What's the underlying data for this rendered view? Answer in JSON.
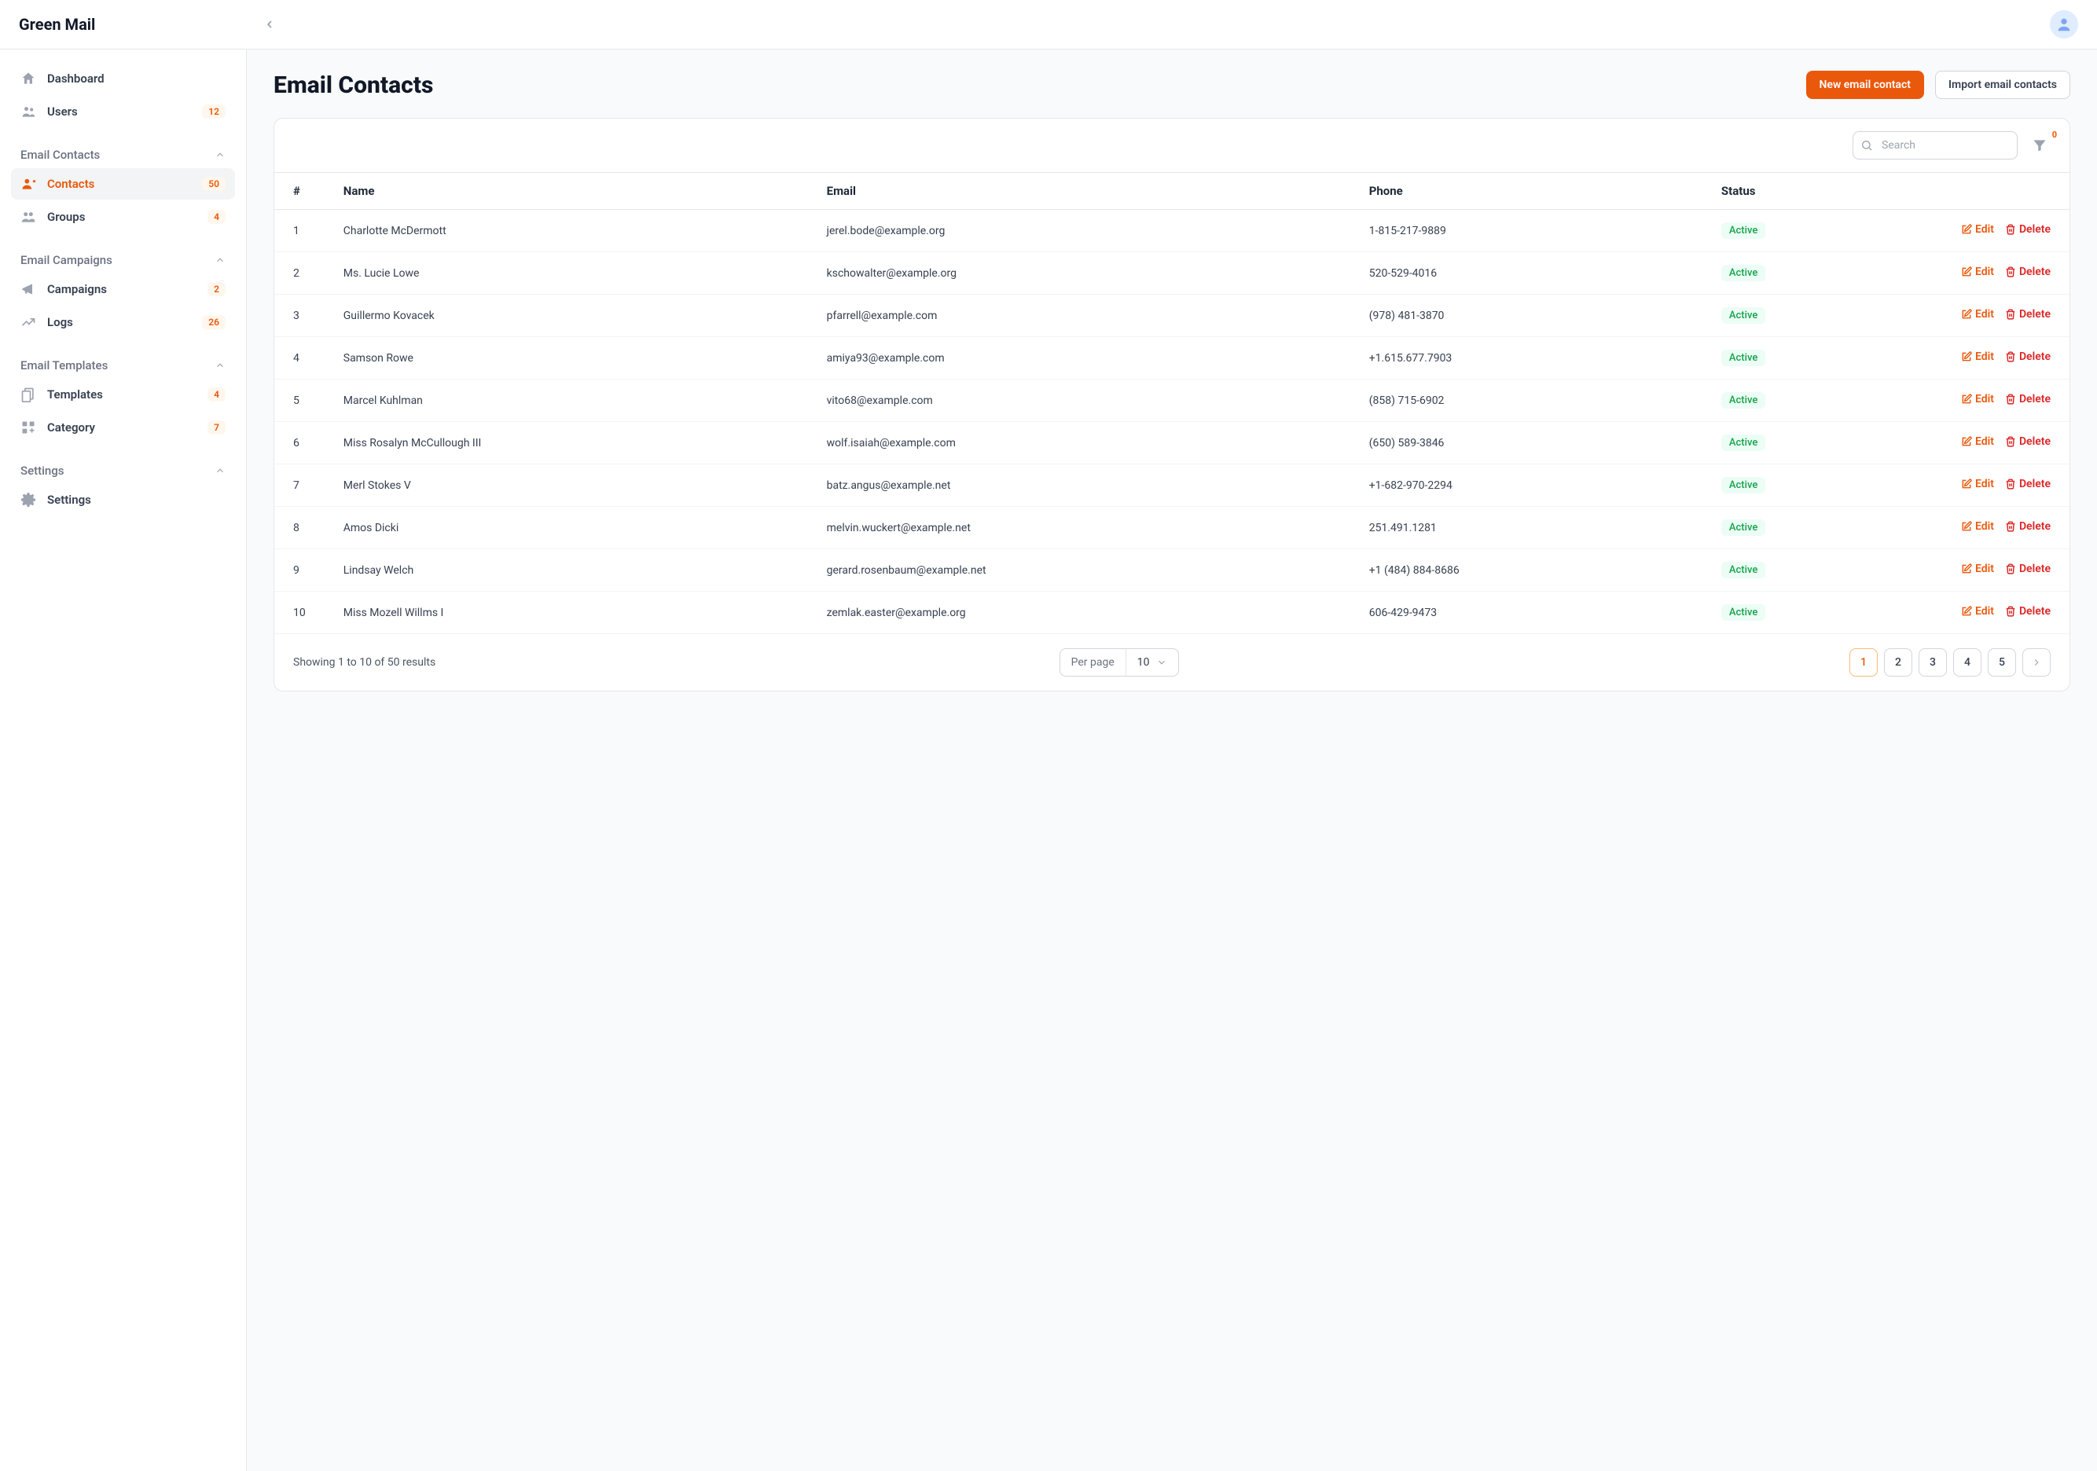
{
  "brand": "Green Mail",
  "sidebar": {
    "items_top": [
      {
        "label": "Dashboard",
        "badge": ""
      },
      {
        "label": "Users",
        "badge": "12"
      }
    ],
    "sections": [
      {
        "title": "Email Contacts",
        "items": [
          {
            "label": "Contacts",
            "badge": "50",
            "active": true
          },
          {
            "label": "Groups",
            "badge": "4"
          }
        ]
      },
      {
        "title": "Email Campaigns",
        "items": [
          {
            "label": "Campaigns",
            "badge": "2"
          },
          {
            "label": "Logs",
            "badge": "26"
          }
        ]
      },
      {
        "title": "Email Templates",
        "items": [
          {
            "label": "Templates",
            "badge": "4"
          },
          {
            "label": "Category",
            "badge": "7"
          }
        ]
      },
      {
        "title": "Settings",
        "items": [
          {
            "label": "Settings",
            "badge": ""
          }
        ]
      }
    ]
  },
  "page": {
    "title": "Email Contacts",
    "new_btn": "New email contact",
    "import_btn": "Import email contacts",
    "search_placeholder": "Search",
    "filter_badge": "0",
    "headers": {
      "num": "#",
      "name": "Name",
      "email": "Email",
      "phone": "Phone",
      "status": "Status"
    },
    "rows": [
      {
        "num": "1",
        "name": "Charlotte McDermott",
        "email": "jerel.bode@example.org",
        "phone": "1-815-217-9889",
        "status": "Active"
      },
      {
        "num": "2",
        "name": "Ms. Lucie Lowe",
        "email": "kschowalter@example.org",
        "phone": "520-529-4016",
        "status": "Active"
      },
      {
        "num": "3",
        "name": "Guillermo Kovacek",
        "email": "pfarrell@example.com",
        "phone": "(978) 481-3870",
        "status": "Active"
      },
      {
        "num": "4",
        "name": "Samson Rowe",
        "email": "amiya93@example.com",
        "phone": "+1.615.677.7903",
        "status": "Active"
      },
      {
        "num": "5",
        "name": "Marcel Kuhlman",
        "email": "vito68@example.com",
        "phone": "(858) 715-6902",
        "status": "Active"
      },
      {
        "num": "6",
        "name": "Miss Rosalyn McCullough III",
        "email": "wolf.isaiah@example.com",
        "phone": "(650) 589-3846",
        "status": "Active"
      },
      {
        "num": "7",
        "name": "Merl Stokes V",
        "email": "batz.angus@example.net",
        "phone": "+1-682-970-2294",
        "status": "Active"
      },
      {
        "num": "8",
        "name": "Amos Dicki",
        "email": "melvin.wuckert@example.net",
        "phone": "251.491.1281",
        "status": "Active"
      },
      {
        "num": "9",
        "name": "Lindsay Welch",
        "email": "gerard.rosenbaum@example.net",
        "phone": "+1 (484) 884-8686",
        "status": "Active"
      },
      {
        "num": "10",
        "name": "Miss Mozell Willms I",
        "email": "zemlak.easter@example.org",
        "phone": "606-429-9473",
        "status": "Active"
      }
    ],
    "edit_label": "Edit",
    "delete_label": "Delete",
    "results_text": "Showing 1 to 10 of 50 results",
    "perpage_label": "Per page",
    "perpage_value": "10",
    "pages": [
      "1",
      "2",
      "3",
      "4",
      "5"
    ]
  }
}
